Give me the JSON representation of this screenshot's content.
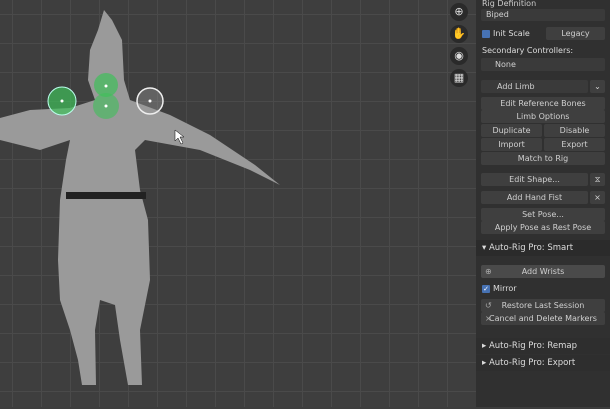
{
  "viewport": {
    "nav_icons": [
      "zoom-icon",
      "hand-pan-icon",
      "camera-icon",
      "grid-icon"
    ]
  },
  "panel": {
    "rig_definition_label": "Rig Definition",
    "rig_type": "Biped",
    "init_scale": "Init Scale",
    "legacy": "Legacy",
    "secondary_controllers_label": "Secondary Controllers:",
    "secondary_controllers_value": "None",
    "add_limb": "Add Limb",
    "edit_reference_bones": "Edit Reference Bones",
    "limb_options": "Limb Options",
    "duplicate": "Duplicate",
    "disable": "Disable",
    "import": "Import",
    "export": "Export",
    "match_to_rig": "Match to Rig",
    "edit_shape": "Edit Shape...",
    "add_hand_fist": "Add Hand Fist",
    "set_pose": "Set Pose...",
    "apply_pose": "Apply Pose as Rest Pose",
    "smart_header": "Auto-Rig Pro: Smart",
    "add_wrists": "Add Wrists",
    "mirror": "Mirror",
    "restore_last_session": "Restore Last Session",
    "cancel_delete_markers": "Cancel and Delete Markers",
    "remap_header": "Auto-Rig Pro: Remap",
    "export_header": "Auto-Rig Pro: Export"
  },
  "colors": {
    "marker_green": "#3fbf5a",
    "checkbox": "#4772b3"
  }
}
